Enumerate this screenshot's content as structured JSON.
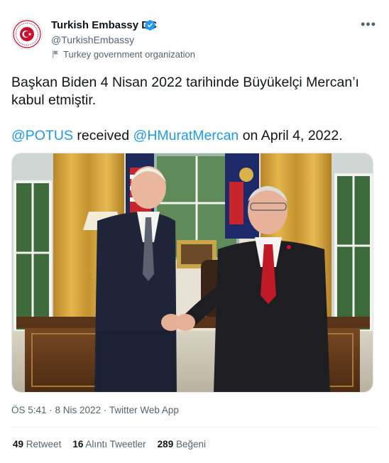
{
  "account": {
    "name": "Turkish Embassy DC",
    "handle": "@TurkishEmbassy",
    "affiliation": "Turkey government organization",
    "verified_color": "#1d9bf0"
  },
  "tweet": {
    "line1": "Başkan Biden 4 Nisan 2022 tarihinde Büyükelçi Mercan’ı kabul etmiştir.",
    "mention1": "@POTUS",
    "middle": " received ",
    "mention2": "@HMuratMercan",
    "end": " on April 4, 2022.",
    "mention_color": "#1d9bf0"
  },
  "meta": {
    "time": "ÖS 5:41",
    "sep": " · ",
    "date": "8 Nis 2022",
    "app": "Twitter Web App"
  },
  "stats": {
    "retweets_count": "49",
    "retweets_label": "Retweet",
    "quotes_count": "16",
    "quotes_label": "Alıntı Tweetler",
    "likes_count": "289",
    "likes_label": "Beğeni"
  },
  "icons": {
    "more": "more-icon",
    "verified": "verified-badge-icon",
    "flag": "flag-icon",
    "avatar": "embassy-seal-icon"
  }
}
